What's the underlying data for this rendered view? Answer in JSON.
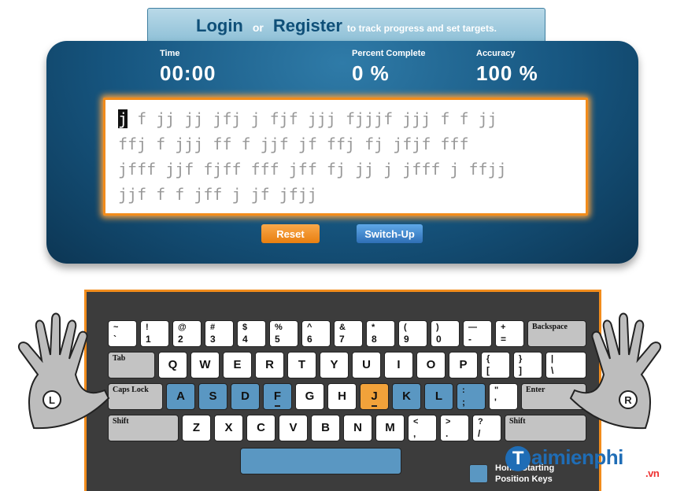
{
  "header": {
    "login": "Login",
    "or": "or",
    "register": "Register",
    "tail": "to track progress and set targets."
  },
  "stats": {
    "time": {
      "label": "Time",
      "value": "00:00"
    },
    "percent": {
      "label": "Percent Complete",
      "value": "0 %"
    },
    "accuracy": {
      "label": "Accuracy",
      "value": "100 %"
    }
  },
  "practice": {
    "cursor_char": "j",
    "line1_rest": " f jj jj jfj j fjf jjj fjjjf jjj f f jj",
    "line2": "ffj f jjj ff f jjf jf ffj fj jfjf fff",
    "line3": "jfff jjf fjff fff jff fj jj j jfff j ffjj",
    "line4": "jjf f f jff j jf jfjj"
  },
  "buttons": {
    "reset": "Reset",
    "switch_up": "Switch-Up"
  },
  "keyboard": {
    "row1": [
      {
        "top": "~",
        "bottom": "`"
      },
      {
        "top": "!",
        "bottom": "1"
      },
      {
        "top": "@",
        "bottom": "2"
      },
      {
        "top": "#",
        "bottom": "3"
      },
      {
        "top": "$",
        "bottom": "4"
      },
      {
        "top": "%",
        "bottom": "5"
      },
      {
        "top": "^",
        "bottom": "6"
      },
      {
        "top": "&",
        "bottom": "7"
      },
      {
        "top": "*",
        "bottom": "8"
      },
      {
        "top": "(",
        "bottom": "9"
      },
      {
        "top": ")",
        "bottom": "0"
      },
      {
        "top": "—",
        "bottom": "-"
      },
      {
        "top": "+",
        "bottom": "="
      }
    ],
    "backspace": "Backspace",
    "tab": "Tab",
    "row2": [
      "Q",
      "W",
      "E",
      "R",
      "T",
      "Y",
      "U",
      "I",
      "O",
      "P"
    ],
    "row2_sym": [
      {
        "top": "{",
        "bottom": "["
      },
      {
        "top": "}",
        "bottom": "]"
      },
      {
        "top": "|",
        "bottom": "\\"
      }
    ],
    "caps": "Caps Lock",
    "row3": [
      "A",
      "S",
      "D",
      "F",
      "G",
      "H",
      "J",
      "K",
      "L"
    ],
    "row3_sym": [
      {
        "top": ":",
        "bottom": ";"
      },
      {
        "top": "\"",
        "bottom": "'"
      }
    ],
    "enter": "Enter",
    "shift_left": "Shift",
    "row4": [
      "Z",
      "X",
      "C",
      "V",
      "B",
      "N",
      "M"
    ],
    "row4_sym": [
      {
        "top": "<",
        "bottom": ","
      },
      {
        "top": ">",
        "bottom": "."
      },
      {
        "top": "?",
        "bottom": "/"
      }
    ],
    "shift_right": "Shift",
    "active_key": "J"
  },
  "hands": {
    "left": "L",
    "right": "R"
  },
  "legend": {
    "line1": "Home Starting",
    "line2": "Position Keys"
  },
  "brand": {
    "name": "aimienphi",
    "initial": "T",
    "tld": ".vn"
  },
  "colors": {
    "home_key": "#5a97c2",
    "active_key": "#f2a23a",
    "panel": "#16557f"
  }
}
